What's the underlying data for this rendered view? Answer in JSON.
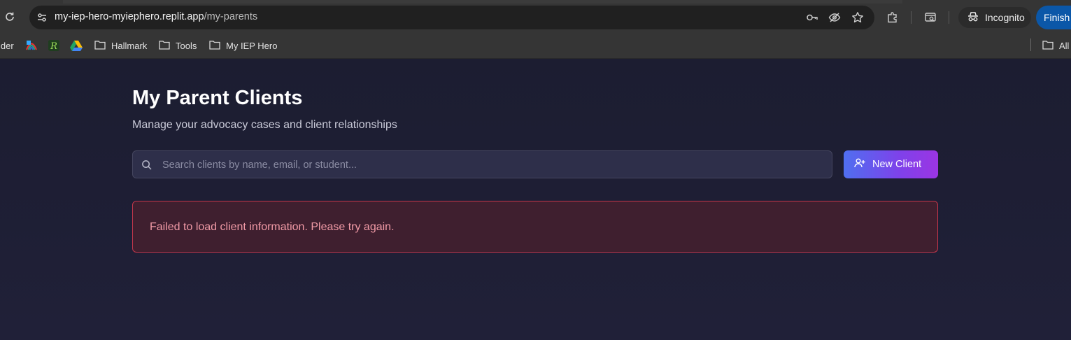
{
  "browser": {
    "url_host": "my-iep-hero-myiephero.replit.app",
    "url_path": "/my-parents",
    "profile_label": "Incognito",
    "finish_label": "Finish",
    "icons": [
      "reload-icon",
      "site-info-icon",
      "key-icon",
      "eye-off-icon",
      "star-icon",
      "extensions-icon",
      "tab-search-icon",
      "incognito-icon"
    ]
  },
  "bookmarks": {
    "items": [
      {
        "label": "lder",
        "icon": "folder-icon"
      },
      {
        "label": "",
        "icon": "rainbow-logo-icon"
      },
      {
        "label": "",
        "icon": "r-logo-icon"
      },
      {
        "label": "",
        "icon": "google-drive-icon"
      },
      {
        "label": "Hallmark",
        "icon": "folder-icon"
      },
      {
        "label": "Tools",
        "icon": "folder-icon"
      },
      {
        "label": "My IEP Hero",
        "icon": "folder-icon"
      },
      {
        "label": "All",
        "icon": "folder-icon"
      }
    ]
  },
  "page": {
    "title": "My Parent Clients",
    "subtitle": "Manage your advocacy cases and client relationships",
    "search": {
      "placeholder": "Search clients by name, email, or student...",
      "value": ""
    },
    "new_client_label": "New Client",
    "error_message": "Failed to load client information. Please try again."
  },
  "colors": {
    "background": "#1e1f33",
    "button_gradient_start": "#4f6ff0",
    "button_gradient_end": "#9b35e3",
    "error_border": "#c2364b",
    "error_text": "#f19aa6"
  }
}
